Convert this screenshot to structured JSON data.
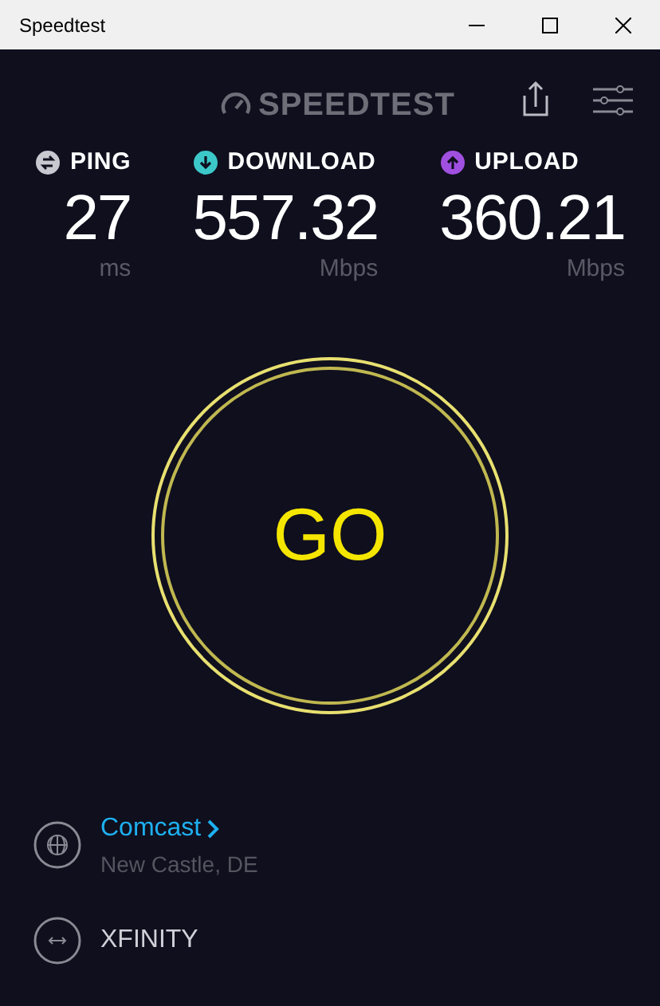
{
  "window": {
    "title": "Speedtest"
  },
  "logo": {
    "text": "SPEEDTEST"
  },
  "metrics": [
    {
      "kind": "ping",
      "label": "PING",
      "value": "27",
      "unit": "ms",
      "color": "#c8c8d0"
    },
    {
      "kind": "download",
      "label": "DOWNLOAD",
      "value": "557.32",
      "unit": "Mbps",
      "color": "#3cc8c8"
    },
    {
      "kind": "upload",
      "label": "UPLOAD",
      "value": "360.21",
      "unit": "Mbps",
      "color": "#a050e0"
    }
  ],
  "go_button": {
    "label": "GO"
  },
  "isp": {
    "name": "Comcast",
    "location": "New Castle, DE"
  },
  "server": {
    "name": "XFINITY"
  }
}
